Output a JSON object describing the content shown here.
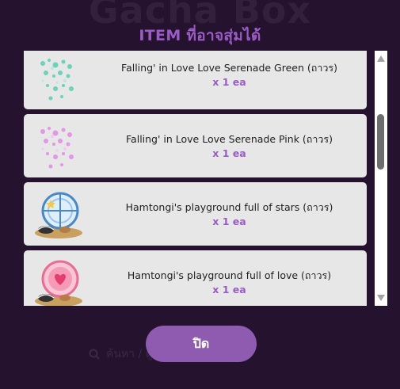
{
  "background": {
    "title": "Gacha Box",
    "search_hint": "ค้นหา / ดูประวัติการสุ่ม",
    "search_icon": "search-icon"
  },
  "modal": {
    "title": "ITEM ที่อาจสุ่มได้",
    "close_label": "ปิด",
    "accent_color": "#9a5cc4",
    "button_color": "#8e5bb0"
  },
  "items": [
    {
      "name": "Falling' in Love Love Serenade Green (ถาวร)",
      "qty": "x 1 ea",
      "icon": "green-hearts-icon"
    },
    {
      "name": "Falling' in Love Love Serenade Pink (ถาวร)",
      "qty": "x 1 ea",
      "icon": "pink-hearts-icon"
    },
    {
      "name": "Hamtongi's playground full of stars (ถาวร)",
      "qty": "x 1 ea",
      "icon": "star-playground-icon"
    },
    {
      "name": "Hamtongi's playground full of love (ถาวร)",
      "qty": "x 1 ea",
      "icon": "love-playground-icon"
    }
  ]
}
